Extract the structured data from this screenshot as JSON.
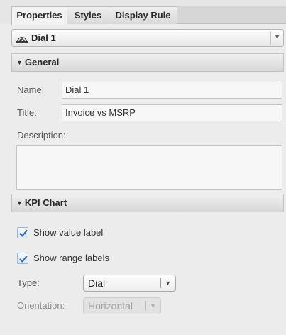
{
  "tabs": [
    {
      "label": "Properties",
      "active": true
    },
    {
      "label": "Styles",
      "active": false
    },
    {
      "label": "Display Rule",
      "active": false
    }
  ],
  "component_selector": {
    "value": "Dial 1",
    "icon": "dial-gauge-icon"
  },
  "general": {
    "header": "General",
    "name_label": "Name:",
    "name_value": "Dial 1",
    "title_label": "Title:",
    "title_value": "Invoice vs MSRP",
    "description_label": "Description:",
    "description_value": ""
  },
  "kpi_chart": {
    "header": "KPI Chart",
    "show_value_label": {
      "label": "Show value label",
      "checked": true
    },
    "show_range_labels": {
      "label": "Show range labels",
      "checked": true
    },
    "type_label": "Type:",
    "type_value": "Dial",
    "orientation_label": "Orientation:",
    "orientation_value": "Horizontal",
    "orientation_enabled": false
  },
  "colors": {
    "checkmark": "#2f6fb8",
    "header_gradient_top": "#f0f0f0",
    "header_gradient_bottom": "#d7d7d7",
    "panel_background": "#ececec"
  }
}
